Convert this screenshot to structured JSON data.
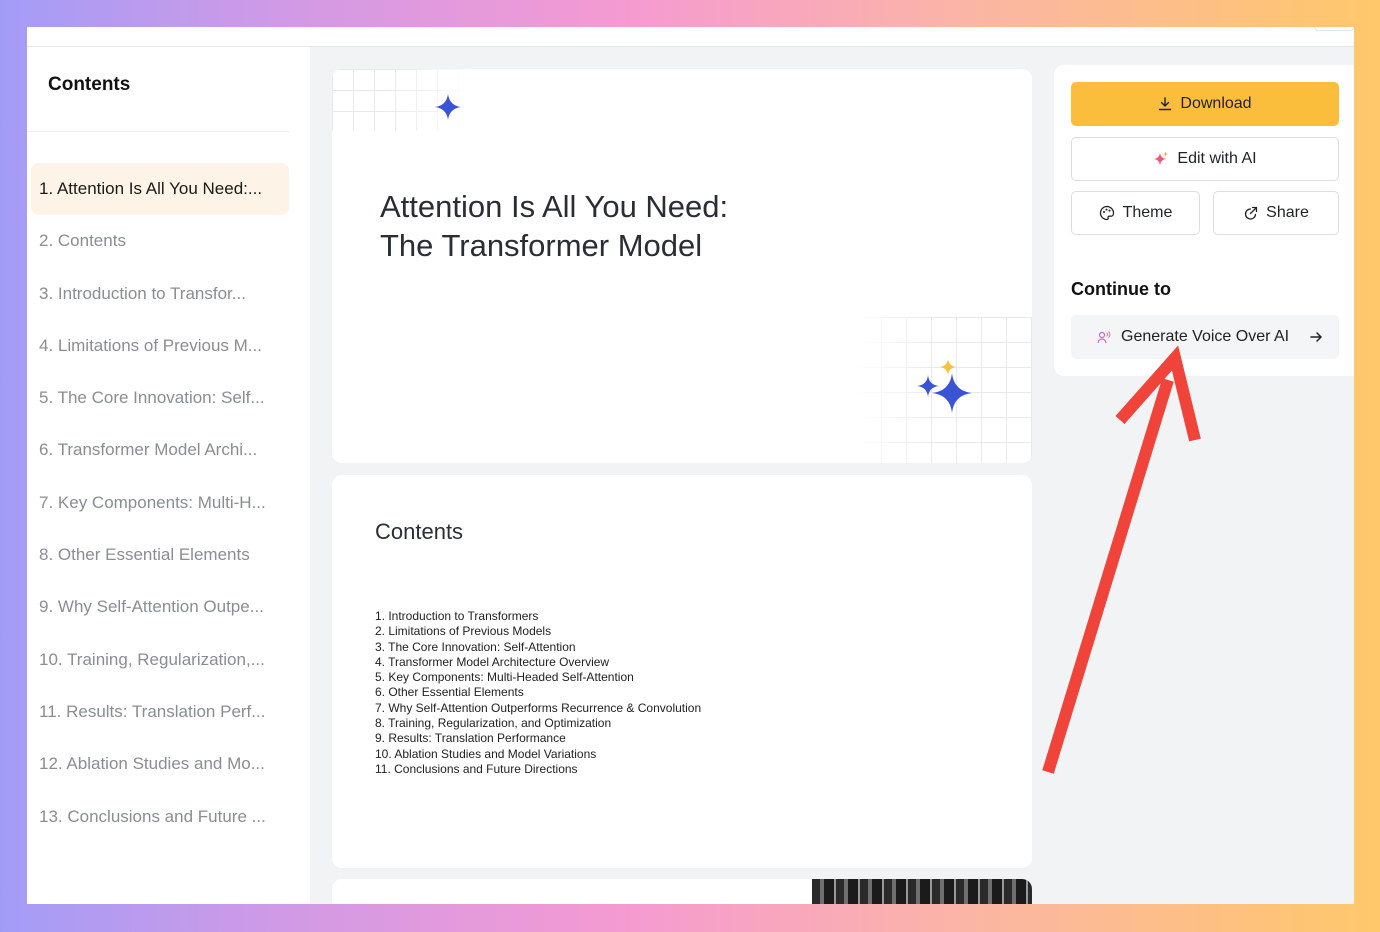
{
  "sidebar": {
    "title": "Contents",
    "items": [
      {
        "label": "1. Attention Is All You Need:..."
      },
      {
        "label": "2. Contents"
      },
      {
        "label": "3. Introduction to Transfor..."
      },
      {
        "label": "4. Limitations of Previous M..."
      },
      {
        "label": "5. The Core Innovation: Self..."
      },
      {
        "label": "6. Transformer Model Archi..."
      },
      {
        "label": "7. Key Components: Multi-H..."
      },
      {
        "label": "8. Other Essential Elements"
      },
      {
        "label": "9. Why Self-Attention Outpe..."
      },
      {
        "label": "10. Training, Regularization,..."
      },
      {
        "label": "11. Results: Translation Perf..."
      },
      {
        "label": "12. Ablation Studies and Mo..."
      },
      {
        "label": "13. Conclusions and Future ..."
      }
    ]
  },
  "slides": {
    "title_slide": {
      "line1": "Attention Is All You Need:",
      "line2": "The Transformer Model"
    },
    "contents_slide": {
      "title": "Contents",
      "items": [
        "1. Introduction to Transformers",
        "2. Limitations of Previous Models",
        "3. The Core Innovation: Self-Attention",
        "4. Transformer Model Architecture Overview",
        "5. Key Components: Multi-Headed Self-Attention",
        "6. Other Essential Elements",
        "7. Why Self-Attention Outperforms Recurrence & Convolution",
        "8. Training, Regularization, and Optimization",
        "9. Results: Translation Performance",
        "10. Ablation Studies and Model Variations",
        "11. Conclusions and Future Directions"
      ]
    }
  },
  "panel": {
    "download_label": "Download",
    "edit_label": "Edit with AI",
    "theme_label": "Theme",
    "share_label": "Share",
    "continue_title": "Continue to",
    "voice_label": "Generate Voice Over AI"
  },
  "colors": {
    "accent": "#fbbd3c",
    "sparkle_blue": "#3b54d6",
    "sparkle_yellow": "#f9c13f",
    "annotation_red": "#f0433a",
    "active_item_bg": "#fdf3e6"
  }
}
